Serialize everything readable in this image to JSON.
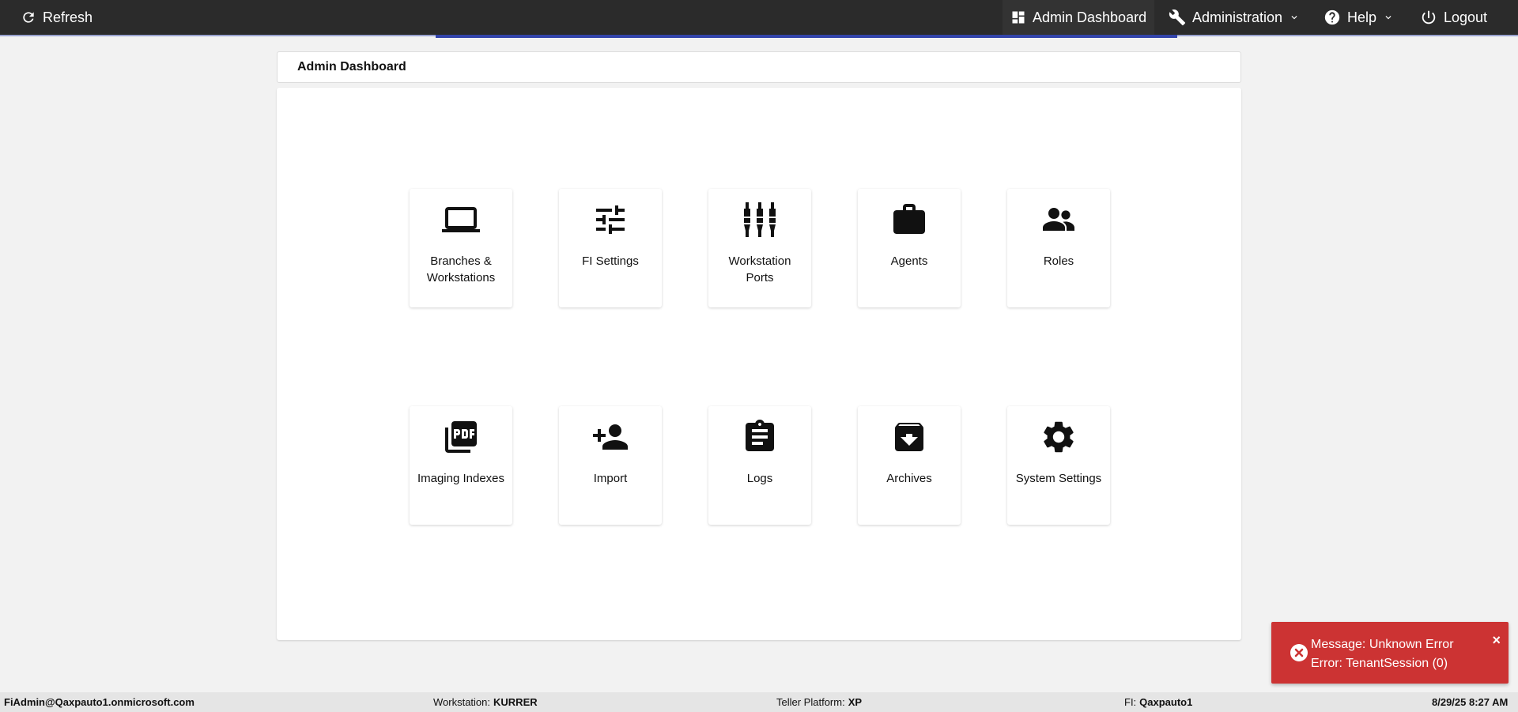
{
  "topbar": {
    "refresh_label": "Refresh",
    "admin_dashboard_label": "Admin Dashboard",
    "administration_label": "Administration",
    "help_label": "Help",
    "logout_label": "Logout"
  },
  "page": {
    "title": "Admin Dashboard"
  },
  "tiles": [
    {
      "label": "Branches & Workstations",
      "icon": "laptop-icon"
    },
    {
      "label": "FI Settings",
      "icon": "tune-icon"
    },
    {
      "label": "Workstation Ports",
      "icon": "ports-icon"
    },
    {
      "label": "Agents",
      "icon": "briefcase-icon"
    },
    {
      "label": "Roles",
      "icon": "people-icon"
    },
    {
      "label": "Imaging Indexes",
      "icon": "pdf-icon"
    },
    {
      "label": "Import",
      "icon": "person-add-icon"
    },
    {
      "label": "Logs",
      "icon": "clipboard-icon"
    },
    {
      "label": "Archives",
      "icon": "archive-icon"
    },
    {
      "label": "System Settings",
      "icon": "gear-icon"
    }
  ],
  "toast": {
    "line1": "Message: Unknown Error",
    "line2": "Error: TenantSession (0)",
    "close": "×",
    "color": "#cc3333"
  },
  "status": {
    "user": "FiAdmin@Qaxpauto1.onmicrosoft.com",
    "workstation_label": "Workstation:",
    "workstation_value": "KURRER",
    "platform_label": "Teller Platform:",
    "platform_value": "XP",
    "fi_label": "FI:",
    "fi_value": "Qaxpauto1",
    "datetime": "8/29/25 8:27 AM"
  },
  "colors": {
    "topbar": "#2b2b2b",
    "accent": "#3344aa"
  }
}
